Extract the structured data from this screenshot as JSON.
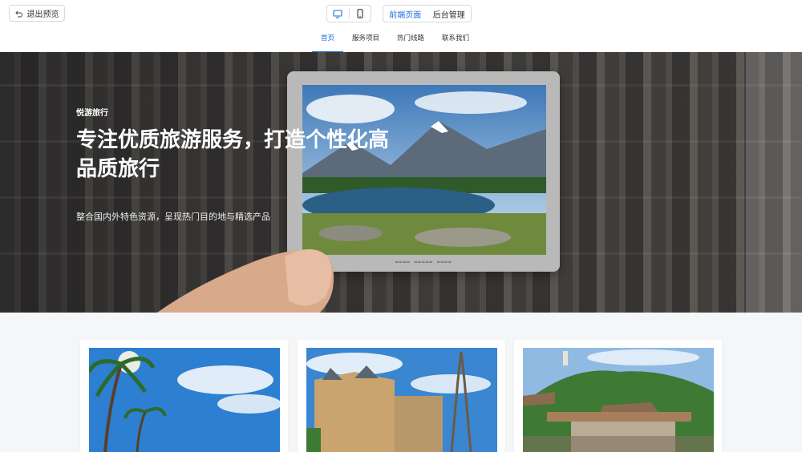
{
  "toolbar": {
    "exit_label": "退出预览",
    "view_options": [
      "前端页面",
      "后台管理"
    ],
    "active_view": "前端页面"
  },
  "nav": {
    "items": [
      "首页",
      "服务项目",
      "热门线路",
      "联系我们"
    ],
    "active": "首页"
  },
  "hero": {
    "brand": "悦游旅行",
    "headline": "专注优质旅游服务，打造个性化高品质旅行",
    "subline": "整合国内外特色资源，呈现热门目的地与精选产品"
  },
  "colors": {
    "accent": "#1e6fd9",
    "page_bg": "#f5f6f8"
  },
  "icons": {
    "exit": "undo-arrow-icon",
    "desktop": "desktop-monitor-icon",
    "mobile": "mobile-phone-icon"
  }
}
